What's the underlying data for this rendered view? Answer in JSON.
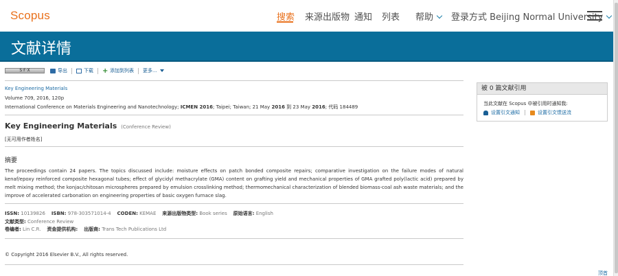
{
  "header": {
    "logo": "Scopus",
    "nav": {
      "search": "搜索",
      "sources": "来源出版物",
      "alerts": "通知",
      "lists": "列表",
      "help": "帮助",
      "login": "登录方式 Beijing Normal University"
    }
  },
  "banner": {
    "title": "文献详情"
  },
  "toolbar": {
    "sfx": "S·F·X",
    "export": "导出",
    "download": "下载",
    "add_to_list": "添加到列表",
    "more": "更多..."
  },
  "source": {
    "journal": "Key Engineering Materials",
    "volume_line": "Volume 709, 2016, 120p",
    "conference_prefix": "International Conference on Materials Engineering and Nanotechnology;",
    "conference_acronym": "ICMEN 2016",
    "location_prefix": "; Taipei; Taiwan; 21 May",
    "year1": "2016",
    "to": "到",
    "date2": "23 May",
    "year2": "2016",
    "code": "; 代码 184489"
  },
  "document": {
    "title": "Key Engineering Materials",
    "type": "(Conference Review)",
    "authors": "[无可用作者姓名]"
  },
  "abstract": {
    "heading": "摘要",
    "text": "The proceedings contain 24 papers. The topics discussed include: moisture effects on patch bonded composite repairs; comparative investigation on the failure modes of natural kenaf/epoxy reinforced composite hexagonal tubes; effect of glycidyl methacrylate (GMA) content on grafting yield and mechanical properties of GMA grafted poly(lactic acid) prepared by melt mixing method; the konjac/chitosan microspheres prepared by emulsion crosslinking method; thermomechanical characterization of blended biomass-coal ash waste materials; and the improve of accelerated carbonation on engineering properties of basic oxygen furnace slag."
  },
  "metadata": {
    "issn_label": "ISSN:",
    "issn": "10139826",
    "isbn_label": "ISBN:",
    "isbn": "978-303571014-4",
    "coden_label": "CODEN:",
    "coden": "KEMAE",
    "source_type_label": "来源出版物类型:",
    "source_type": "Book series",
    "language_label": "原始语言:",
    "language": "English",
    "doc_type_label": "文献类型:",
    "doc_type": "Conference Review",
    "editor_label": "卷编者:",
    "editor": "Lin C.R.",
    "funding_label": "资金提供机构:",
    "publisher_label": "出版商:",
    "publisher": "Trans Tech Publications Ltd"
  },
  "copyright": "© Copyright 2016 Elsevier B.V., All rights reserved.",
  "sidebar": {
    "cited_by": "被 0 篇文献引用",
    "notify_text": "当此文献在 Scopus 中被引用时通知我:",
    "set_alert": "设置引文通知",
    "set_feed": "设置引文馈送流"
  },
  "footer": {
    "top_link": "顶首"
  },
  "colors": {
    "accent": "#e9711c",
    "banner": "#0a6e9a",
    "link": "#1a6aa3"
  }
}
